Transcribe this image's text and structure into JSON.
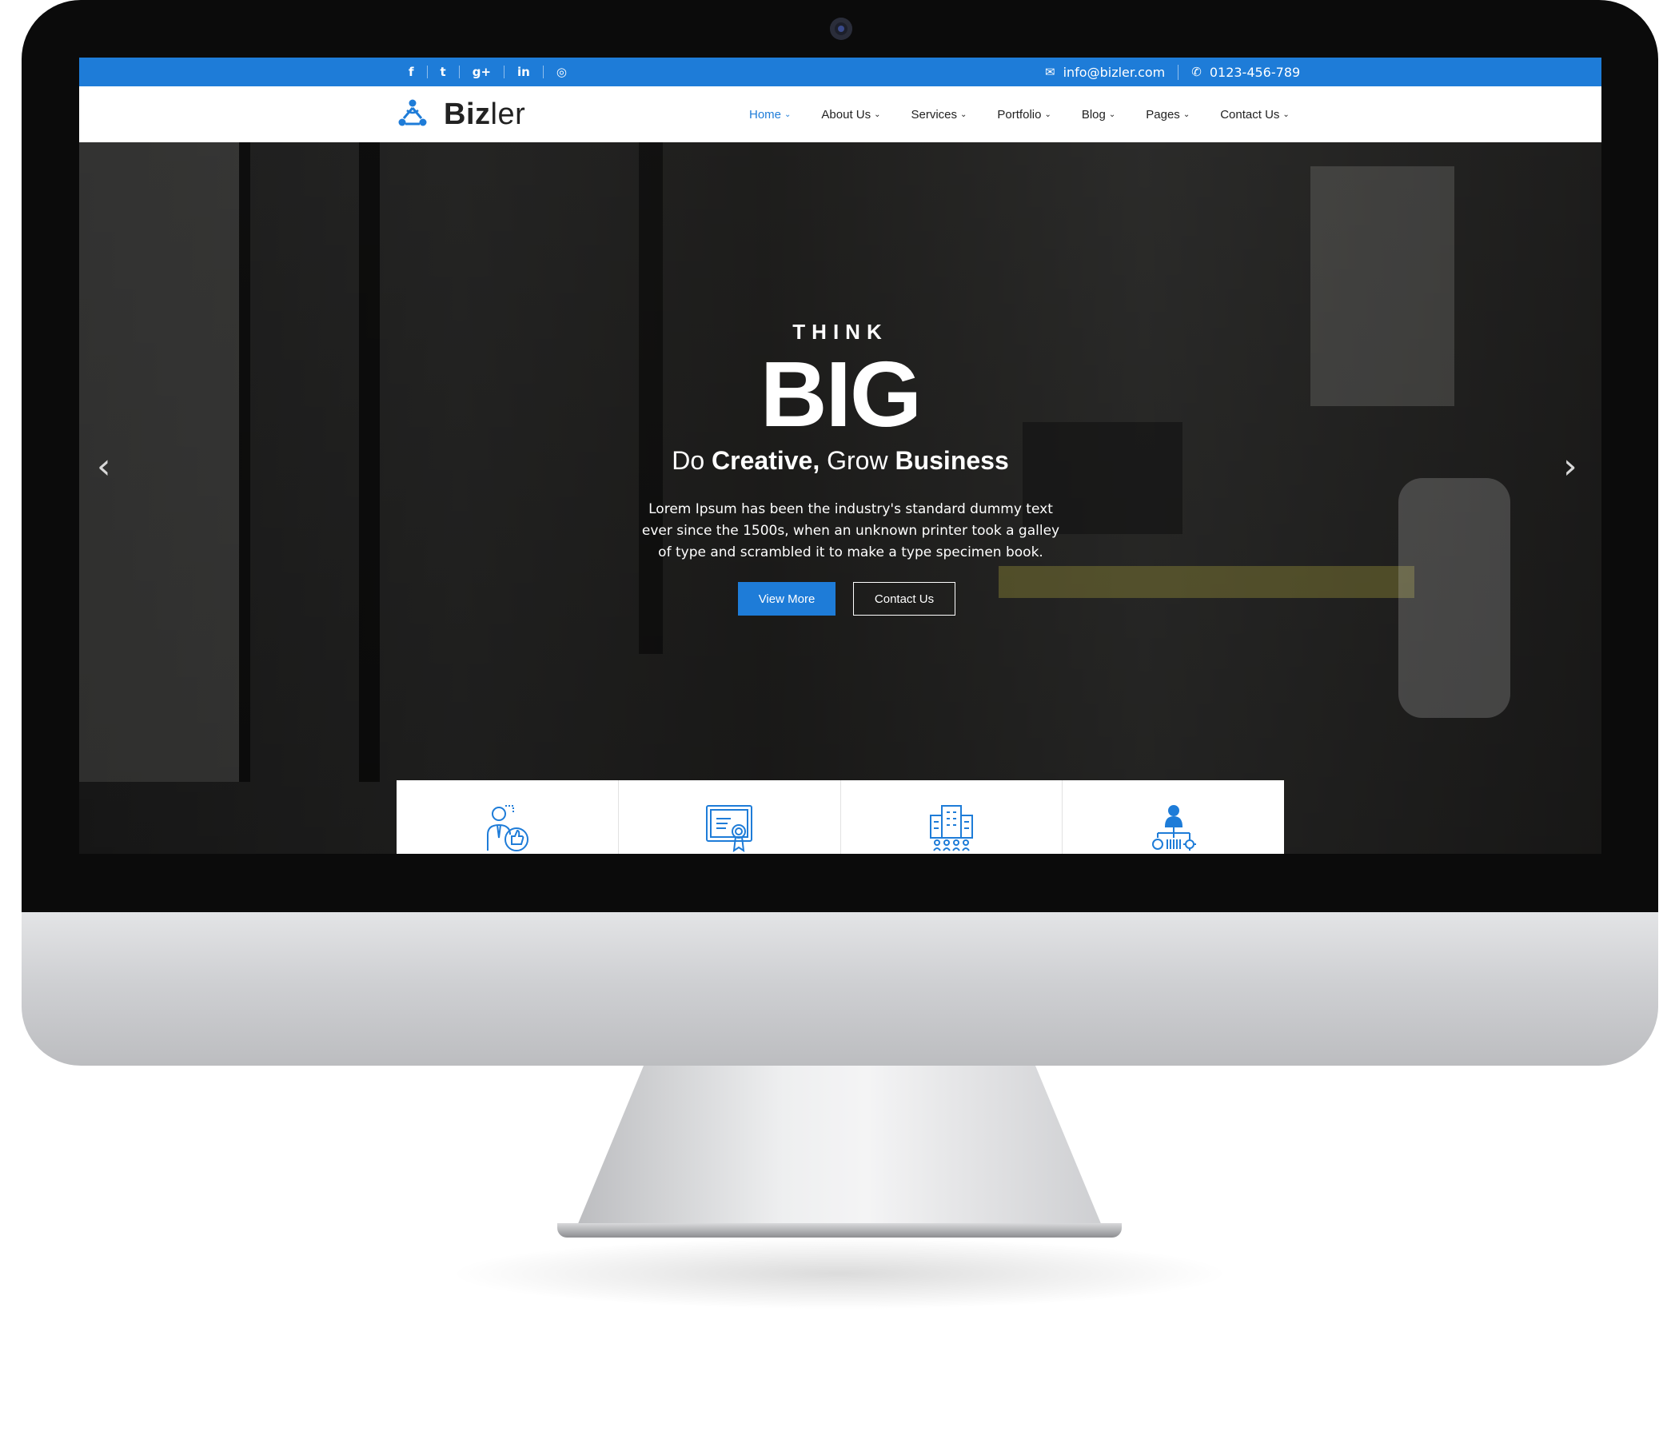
{
  "topbar": {
    "social": [
      {
        "icon": "facebook-icon",
        "glyph": "f"
      },
      {
        "icon": "twitter-icon",
        "glyph": "t"
      },
      {
        "icon": "google-plus-icon",
        "glyph": "g+"
      },
      {
        "icon": "linkedin-icon",
        "glyph": "in"
      },
      {
        "icon": "instagram-icon",
        "glyph": "◎"
      }
    ],
    "email": "info@bizler.com",
    "phone": "0123-456-789"
  },
  "logo": {
    "bold": "Biz",
    "light": "ler"
  },
  "nav": [
    {
      "label": "Home",
      "active": true
    },
    {
      "label": "About Us",
      "active": false
    },
    {
      "label": "Services",
      "active": false
    },
    {
      "label": "Portfolio",
      "active": false
    },
    {
      "label": "Blog",
      "active": false
    },
    {
      "label": "Pages",
      "active": false
    },
    {
      "label": "Contact Us",
      "active": false
    }
  ],
  "hero": {
    "kicker": "THINK",
    "headline": "BIG",
    "tagline_do": "Do ",
    "tagline_creative": "Creative,",
    "tagline_grow": " Grow ",
    "tagline_business": "Business",
    "description": "Lorem Ipsum has been the industry's standard dummy text ever since the 1500s, when an unknown printer took a galley of type and scrambled it to make a type specimen book.",
    "btn_primary": "View More",
    "btn_secondary": "Contact Us",
    "prev": "‹",
    "next": "›"
  },
  "features": [
    {
      "icon": "businessman-thumbs-up-icon"
    },
    {
      "icon": "certificate-icon"
    },
    {
      "icon": "office-building-icon"
    },
    {
      "icon": "team-hierarchy-icon"
    }
  ],
  "colors": {
    "brand_blue": "#1e7cd8",
    "nav_text": "#222222"
  }
}
